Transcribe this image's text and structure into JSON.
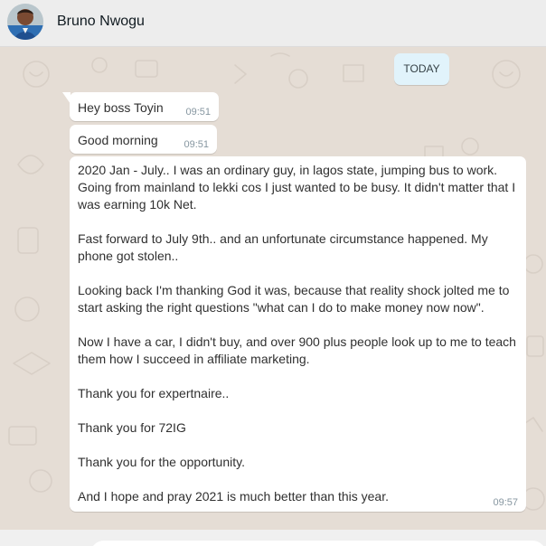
{
  "header": {
    "contact_name": "Bruno Nwogu"
  },
  "chat": {
    "date_chip": "TODAY",
    "messages": [
      {
        "text": "Hey boss Toyin",
        "time": "09:51"
      },
      {
        "text": "Good morning",
        "time": "09:51"
      },
      {
        "paragraphs": [
          "2020 Jan - July.. I was an ordinary guy, in lagos state, jumping bus to work. Going from mainland to lekki cos I just wanted to be busy. It didn't matter that I was earning 10k Net.",
          "Fast forward to July 9th.. and an unfortunate circumstance happened. My phone got stolen..",
          "Looking back I'm thanking God it was, because that reality shock jolted me to start asking the right questions \"what can I do to make money now now\".",
          "Now I have a car, I didn't buy, and over 900 plus people look up to me to teach them how I succeed in affiliate marketing.",
          "Thank you for expertnaire..",
          "Thank you for 72IG",
          "Thank you for the opportunity.",
          "And I hope and pray 2021 is much better than this year."
        ],
        "time": "09:57"
      }
    ]
  },
  "colors": {
    "chat_background": "#e5ddd5",
    "header_background": "#ededed",
    "date_chip_background": "#e1f3fb",
    "bubble_background": "#ffffff",
    "timestamp": "#8696a0"
  },
  "icons": {
    "avatar": "contact-avatar"
  }
}
